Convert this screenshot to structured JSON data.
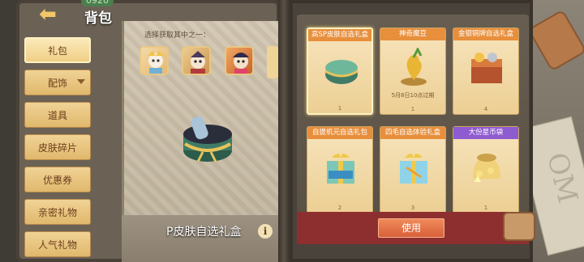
{
  "header": {
    "badge": "0920",
    "title": "背包"
  },
  "sidebar": {
    "items": [
      {
        "label": "礼包",
        "active": true,
        "caret": false
      },
      {
        "label": "配饰",
        "active": false,
        "caret": true
      },
      {
        "label": "道具",
        "active": false,
        "caret": false
      },
      {
        "label": "皮肤碎片",
        "active": false,
        "caret": false
      },
      {
        "label": "优惠券",
        "active": false,
        "caret": false
      },
      {
        "label": "亲密礼物",
        "active": false,
        "caret": false
      },
      {
        "label": "人气礼物",
        "active": false,
        "caret": false
      }
    ]
  },
  "chooser": {
    "label": "选择获取其中之一："
  },
  "preview": {
    "name": "P皮肤自选礼盒",
    "info_icon": "info-icon"
  },
  "cards": [
    {
      "title": "高SP皮肤自选礼盒",
      "count": "1",
      "sub": "",
      "header_color": "#e88f3c",
      "selected": true
    },
    {
      "title": "神奇魔豆",
      "count": "1",
      "sub": "5月8日10点过期",
      "header_color": "#e88f3c",
      "selected": false
    },
    {
      "title": "金银铜牌自选礼盒",
      "count": "4",
      "sub": "",
      "header_color": "#e88f3c",
      "selected": false
    },
    {
      "title": "自提机元自选礼包",
      "count": "2",
      "sub": "",
      "header_color": "#e88f3c",
      "selected": false
    },
    {
      "title": "四毛自选体验礼盒",
      "count": "3",
      "sub": "",
      "header_color": "#e88f3c",
      "selected": false
    },
    {
      "title": "大份星币袋",
      "count": "1",
      "sub": "",
      "header_color": "#8f5bd0",
      "selected": false
    }
  ],
  "actions": {
    "use_label": "使用"
  },
  "background": {
    "paper_text": "OM"
  }
}
